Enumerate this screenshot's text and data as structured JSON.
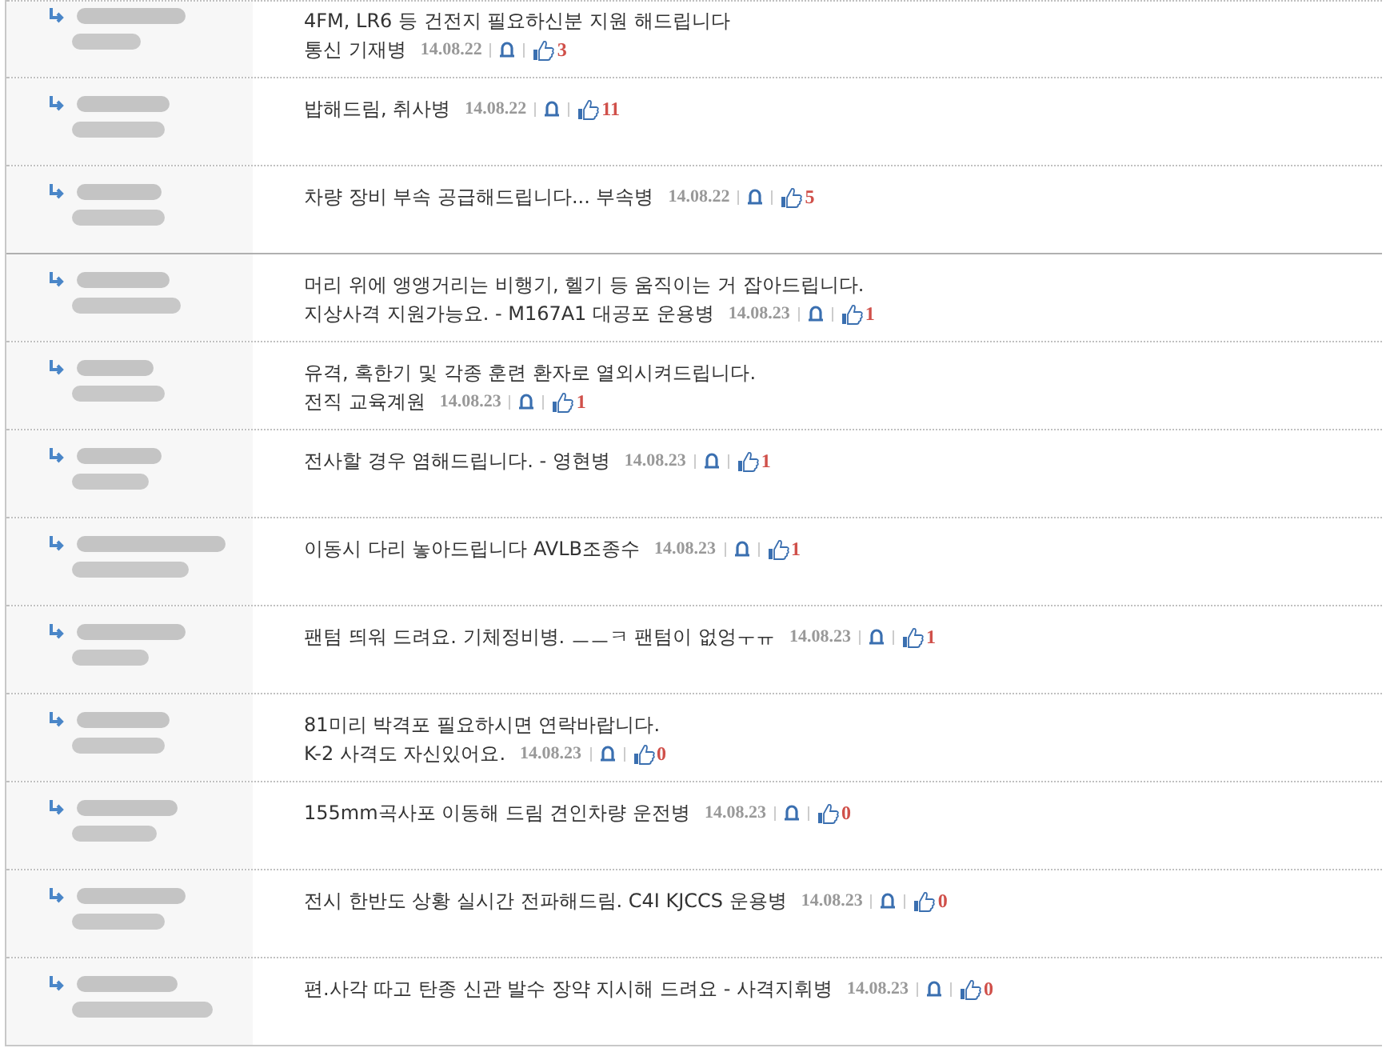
{
  "comments": [
    {
      "lines": [
        "4FM, LR6 등 건전지 필요하신분 지원 해드립니다",
        "통신 기재병"
      ],
      "date": "14.08.22",
      "likes": "3",
      "group_start": false
    },
    {
      "lines": [
        "밥해드림, 취사병"
      ],
      "date": "14.08.22",
      "likes": "11",
      "group_start": false
    },
    {
      "lines": [
        "차량 장비 부속 공급해드립니다... 부속병"
      ],
      "date": "14.08.22",
      "likes": "5",
      "group_start": false
    },
    {
      "lines": [
        "머리 위에 앵앵거리는 비행기, 헬기 등 움직이는 거 잡아드립니다.",
        "지상사격 지원가능요. - M167A1 대공포 운용병"
      ],
      "date": "14.08.23",
      "likes": "1",
      "group_start": true
    },
    {
      "lines": [
        "유격, 혹한기 및 각종 훈련 환자로 열외시켜드립니다.",
        "전직 교육계원"
      ],
      "date": "14.08.23",
      "likes": "1",
      "group_start": false
    },
    {
      "lines": [
        "전사할 경우 염해드립니다. - 영현병"
      ],
      "date": "14.08.23",
      "likes": "1",
      "group_start": false
    },
    {
      "lines": [
        "이동시 다리 놓아드립니다 AVLB조종수"
      ],
      "date": "14.08.23",
      "likes": "1",
      "group_start": false
    },
    {
      "lines": [
        "팬텀 띄워 드려요. 기체정비병. ㅡㅡㅋ 팬텀이 없엉ㅜㅠ"
      ],
      "date": "14.08.23",
      "likes": "1",
      "group_start": false
    },
    {
      "lines": [
        "81미리 박격포 필요하시면 연락바랍니다.",
        "K-2 사격도 자신있어요."
      ],
      "date": "14.08.23",
      "likes": "0",
      "group_start": false
    },
    {
      "lines": [
        "155mm곡사포 이동해 드림 견인차량 운전병"
      ],
      "date": "14.08.23",
      "likes": "0",
      "group_start": false
    },
    {
      "lines": [
        "전시 한반도 상황 실시간 전파해드림. C4I KJCCS 운용병"
      ],
      "date": "14.08.23",
      "likes": "0",
      "group_start": false
    },
    {
      "lines": [
        "편.사각 따고 탄종 신관 발수 장약 지시해 드려요 - 사격지휘병"
      ],
      "date": "14.08.23",
      "likes": "0",
      "group_start": false
    }
  ]
}
